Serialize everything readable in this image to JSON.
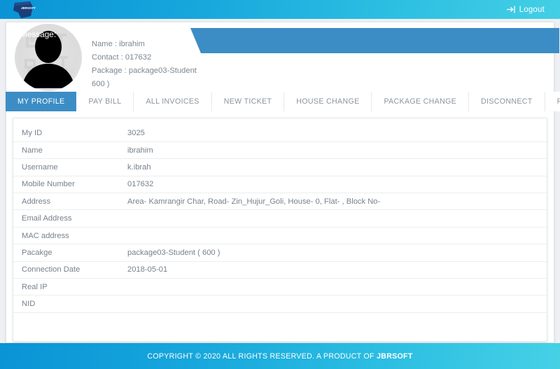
{
  "header": {
    "brand_name": "JBRSOFT",
    "logout_label": "Logout",
    "logout_icon": "logout-arrow-icon",
    "gradient_start": "#0a93d6",
    "gradient_end": "#43cfe5"
  },
  "profile": {
    "avatar_icon": "user-silhouette-avatar",
    "lines": [
      "Name : ibrahim",
      "Contact : 017632",
      "Package : package03-Student (",
      "600 )"
    ],
    "message_label": "Message:",
    "banner_color": "#3c8dc5"
  },
  "tabs": [
    {
      "label": "MY PROFILE",
      "active": true
    },
    {
      "label": "PAY BILL",
      "active": false
    },
    {
      "label": "ALL INVOICES",
      "active": false
    },
    {
      "label": "NEW TICKET",
      "active": false
    },
    {
      "label": "HOUSE CHANGE",
      "active": false
    },
    {
      "label": "PACKAGE CHANGE",
      "active": false
    },
    {
      "label": "DISCONNECT",
      "active": false
    },
    {
      "label": "FIND TRANSACTION",
      "active": false
    }
  ],
  "details": {
    "rows": [
      {
        "label": "My ID",
        "value": "3025"
      },
      {
        "label": "Name",
        "value": "ibrahim"
      },
      {
        "label": "Username",
        "value": "k.ibrah"
      },
      {
        "label": "Mobile Number",
        "value": "017632"
      },
      {
        "label": "Address",
        "value": "Area- Kamrangir Char, Road- Zin_Hujur_Goli, House- 0, Flat- , Block No-"
      },
      {
        "label": "Email Address",
        "value": ""
      },
      {
        "label": "MAC address",
        "value": ""
      },
      {
        "label": "Pacakge",
        "value": "package03-Student ( 600 )"
      },
      {
        "label": "Connection Date",
        "value": "2018-05-01"
      },
      {
        "label": "Real IP",
        "value": ""
      },
      {
        "label": "NID",
        "value": ""
      }
    ]
  },
  "footer": {
    "copyright_prefix": "COPYRIGHT © 2020 ALL RIGHTS RESERVED. A PRODUCT OF ",
    "company": "JBRSOFT"
  }
}
